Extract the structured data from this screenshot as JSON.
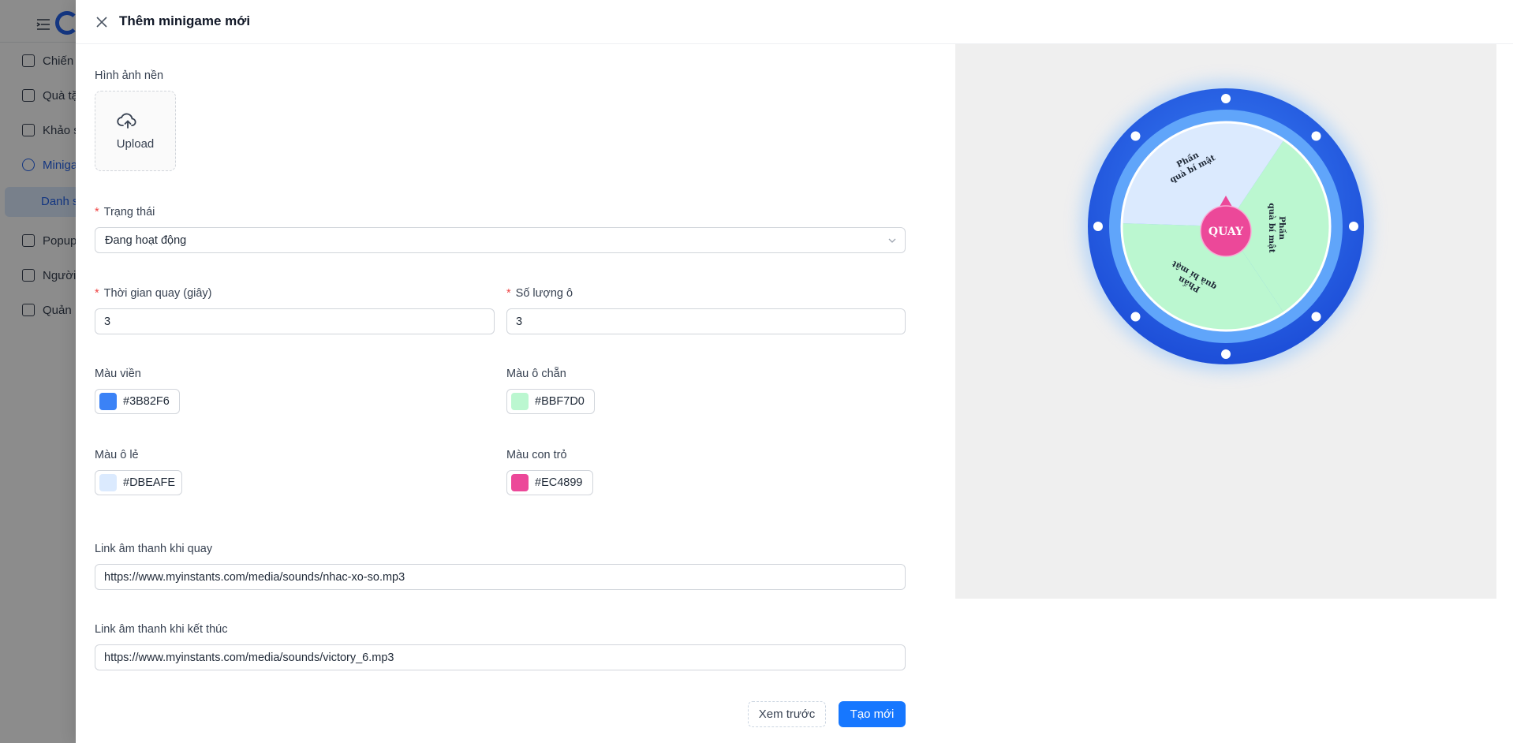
{
  "sidebar": {
    "items": [
      {
        "label": "Chiến",
        "icon": "campaign-icon"
      },
      {
        "label": "Quà tặ",
        "icon": "gift-icon"
      },
      {
        "label": "Khảo s",
        "icon": "survey-icon"
      },
      {
        "label": "Miniga",
        "icon": "game-icon"
      },
      {
        "label": "Popup",
        "icon": "popup-icon"
      },
      {
        "label": "Người",
        "icon": "users-icon"
      },
      {
        "label": "Quản",
        "icon": "manage-icon"
      }
    ],
    "sub_item": "Danh s"
  },
  "drawer": {
    "title": "Thêm minigame mới",
    "background_label": "Hình ảnh nền",
    "upload_label": "Upload",
    "status": {
      "label": "Trạng thái",
      "value": "Đang hoạt động"
    },
    "spin_time": {
      "label": "Thời gian quay (giây)",
      "value": "3"
    },
    "slot_count": {
      "label": "Số lượng ô",
      "value": "3"
    },
    "border_color": {
      "label": "Màu viền",
      "value": "#3B82F6"
    },
    "even_color": {
      "label": "Màu ô chẵn",
      "value": "#BBF7D0"
    },
    "odd_color": {
      "label": "Màu ô lẻ",
      "value": "#DBEAFE"
    },
    "pointer_color": {
      "label": "Màu con trỏ",
      "value": "#EC4899"
    },
    "spin_sound": {
      "label": "Link âm thanh khi quay",
      "value": "https://www.myinstants.com/media/sounds/nhac-xo-so.mp3"
    },
    "end_sound": {
      "label": "Link âm thanh khi kết thúc",
      "value": "https://www.myinstants.com/media/sounds/victory_6.mp3"
    },
    "preview_button": "Xem trước",
    "create_button": "Tạo mới"
  },
  "wheel": {
    "center_label": "QUAY",
    "segment_line1": "Phần",
    "segment_line2": "quà bí mật",
    "colors": {
      "rim": "#2563eb",
      "rim_inner": "#60a5fa",
      "odd": "#DBEAFE",
      "even": "#BBF7D0",
      "pointer": "#EC4899"
    }
  }
}
